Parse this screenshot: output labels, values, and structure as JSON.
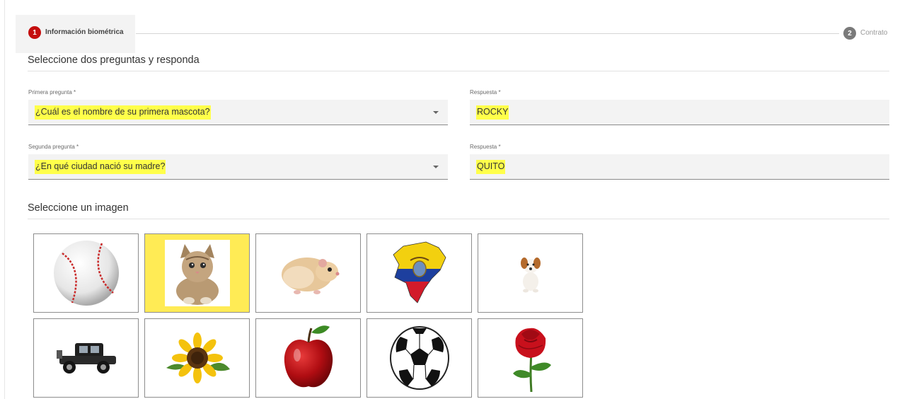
{
  "stepper": {
    "step1": {
      "number": "1",
      "label": "Información biométrica"
    },
    "step2": {
      "number": "2",
      "label": "Contrato"
    }
  },
  "security": {
    "title": "Seleccione dos preguntas y responda",
    "question1": {
      "label": "Primera pregunta *",
      "value": "¿Cuál es el nombre de su primera mascota?"
    },
    "answer1": {
      "label": "Respuesta *",
      "value": "ROCKY"
    },
    "question2": {
      "label": "Segunda pregunta *",
      "value": "¿En qué ciudad nació su madre?"
    },
    "answer2": {
      "label": "Respuesta *",
      "value": "QUITO"
    }
  },
  "image_selection": {
    "title": "Seleccione un imagen",
    "selected": "cat",
    "images": [
      "baseball",
      "cat",
      "hamster",
      "ecuador-map",
      "puppy",
      "antique-car",
      "sunflower",
      "apple",
      "soccer-ball",
      "rose"
    ]
  },
  "colors": {
    "accent_red": "#c40d0d",
    "highlight_yellow": "#ffff4a",
    "selected_tile": "#ffeb55"
  }
}
